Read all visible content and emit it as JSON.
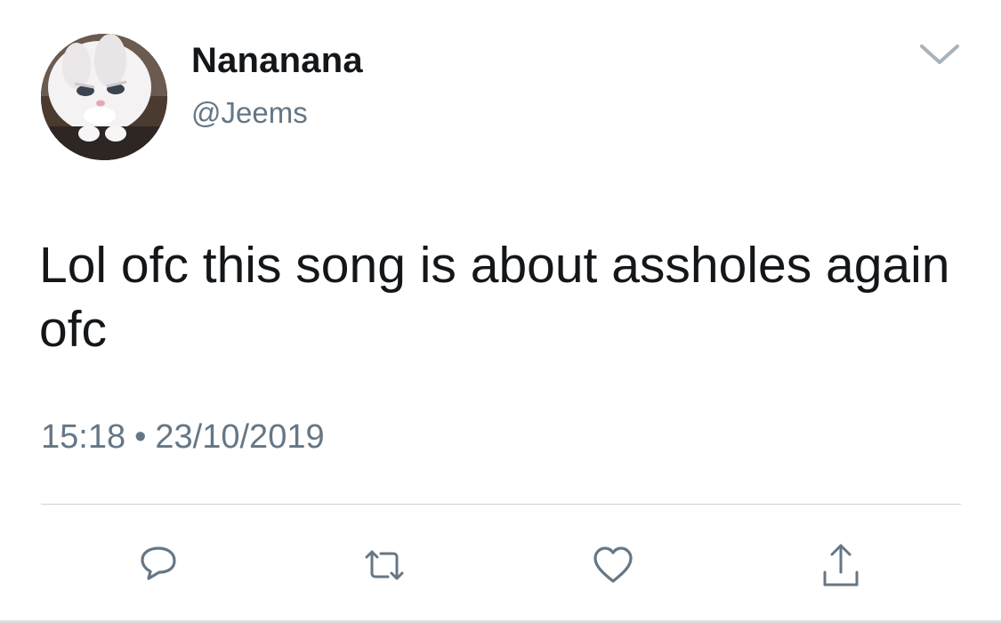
{
  "tweet": {
    "display_name": "Nananana",
    "handle": "@Jeems",
    "text": "Lol ofc this song is about assholes again ofc",
    "time": "15:18",
    "separator": "•",
    "date": "23/10/2019"
  },
  "icons": {
    "menu": "chevron-down-icon",
    "reply": "reply-icon",
    "retweet": "retweet-icon",
    "like": "heart-icon",
    "share": "share-icon"
  },
  "colors": {
    "text_primary": "#14171a",
    "text_secondary": "#657786",
    "icon": "#657786",
    "divider": "#cfd5da"
  }
}
